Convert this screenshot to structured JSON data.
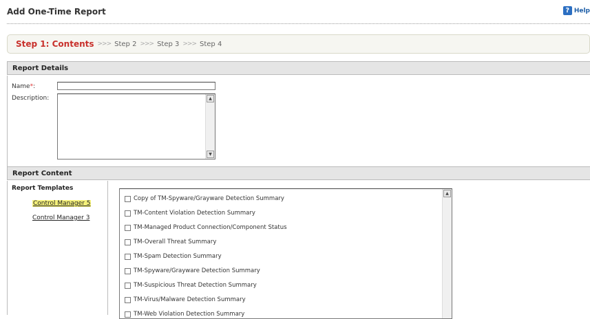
{
  "header": {
    "title": "Add One-Time Report",
    "help_label": "Help",
    "help_icon": "help-icon"
  },
  "wizard": {
    "current": "Step 1: Contents",
    "separator": ">>>",
    "steps": [
      "Step 2",
      "Step 3",
      "Step 4"
    ]
  },
  "report_details": {
    "header": "Report Details",
    "name_label": "Name",
    "required_mark": "*",
    "name_colon": ":",
    "name_value": "",
    "description_label": "Description:",
    "description_value": ""
  },
  "report_content": {
    "header": "Report Content",
    "templates_title": "Report Templates",
    "template_groups": [
      {
        "label": "Control Manager 5",
        "selected": true
      },
      {
        "label": "Control Manager 3",
        "selected": false
      }
    ],
    "templates": [
      "Copy of TM-Spyware/Grayware Detection Summary",
      "TM-Content Violation Detection Summary",
      "TM-Managed Product Connection/Component Status",
      "TM-Overall Threat Summary",
      "TM-Spam Detection Summary",
      "TM-Spyware/Grayware Detection Summary",
      "TM-Suspicious Threat Detection Summary",
      "TM-Virus/Malware Detection Summary",
      "TM-Web Violation Detection Summary"
    ]
  },
  "colors": {
    "current_step": "#c8302b",
    "highlight": "#f4f07a",
    "help": "#1f5fa8"
  }
}
